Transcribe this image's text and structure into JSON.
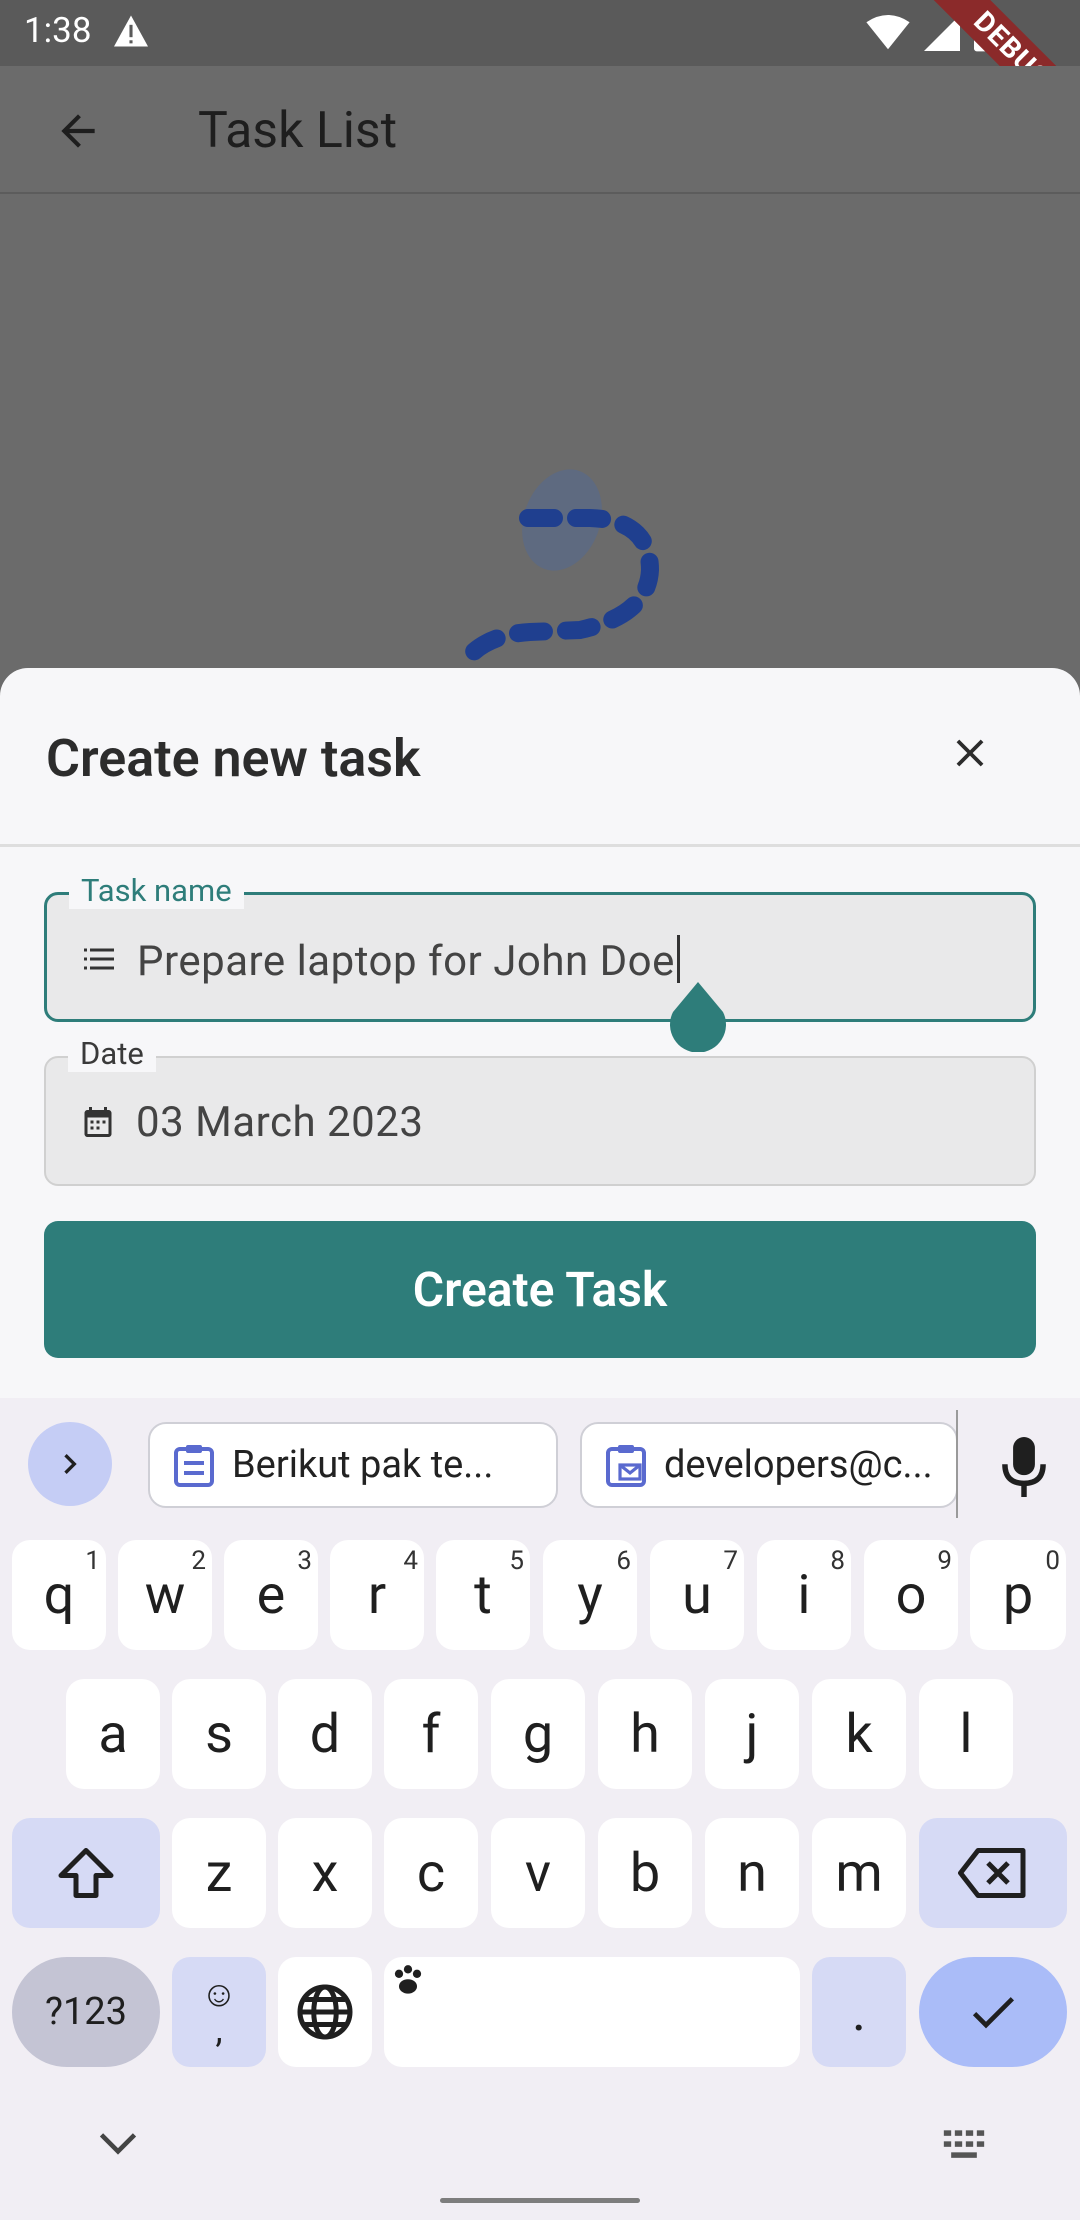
{
  "status_bar": {
    "time": "1:38",
    "debug_label": "DEBUG"
  },
  "app_bar": {
    "title": "Task List"
  },
  "sheet": {
    "title": "Create new task",
    "task_field": {
      "label": "Task name",
      "value": "Prepare laptop for John Doe"
    },
    "date_field": {
      "label": "Date",
      "value": "03 March 2023"
    },
    "submit_label": "Create Task"
  },
  "keyboard": {
    "suggestions": [
      "Berikut pak te...",
      "developers@c..."
    ],
    "row1": [
      {
        "k": "q",
        "s": "1"
      },
      {
        "k": "w",
        "s": "2"
      },
      {
        "k": "e",
        "s": "3"
      },
      {
        "k": "r",
        "s": "4"
      },
      {
        "k": "t",
        "s": "5"
      },
      {
        "k": "y",
        "s": "6"
      },
      {
        "k": "u",
        "s": "7"
      },
      {
        "k": "i",
        "s": "8"
      },
      {
        "k": "o",
        "s": "9"
      },
      {
        "k": "p",
        "s": "0"
      }
    ],
    "row2": [
      "a",
      "s",
      "d",
      "f",
      "g",
      "h",
      "j",
      "k",
      "l"
    ],
    "row3": [
      "z",
      "x",
      "c",
      "v",
      "b",
      "n",
      "m"
    ],
    "symbols_label": "?123",
    "emoji_label": "☺",
    "comma_label": ",",
    "period_label": "."
  },
  "colors": {
    "accent": "#2e7d7a",
    "keyboard_mod": "#d6daf5",
    "enter_key": "#aabcf8"
  }
}
